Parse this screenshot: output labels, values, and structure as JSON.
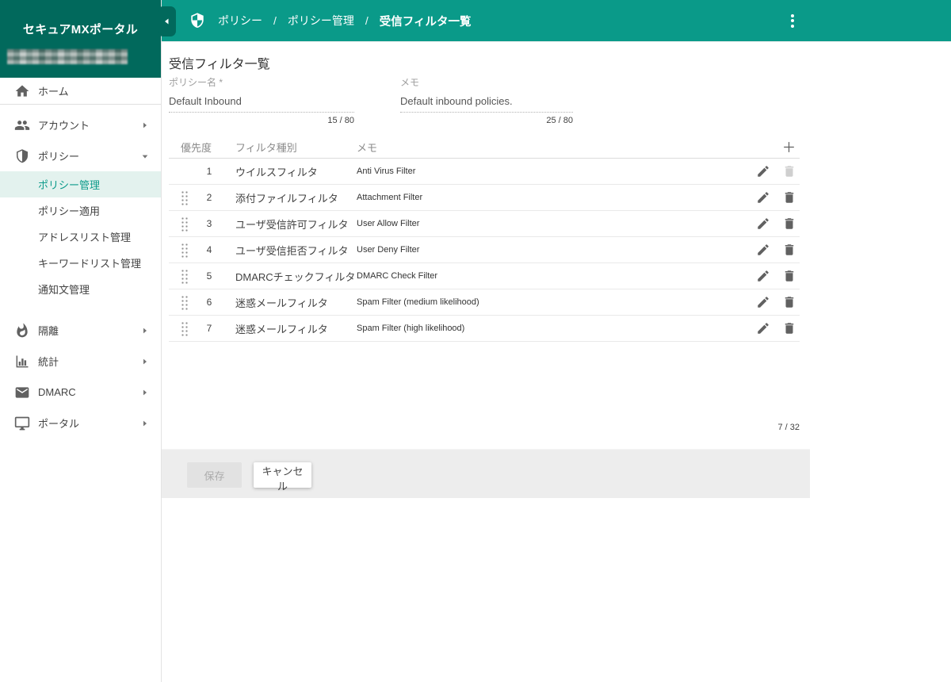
{
  "app": {
    "title": "セキュアMXポータル"
  },
  "breadcrumb": {
    "separator": "/",
    "items": [
      "ポリシー",
      "ポリシー管理",
      "受信フィルタ一覧"
    ]
  },
  "sidebar": {
    "items": [
      {
        "label": "ホーム",
        "icon": "home-icon"
      },
      {
        "label": "アカウント",
        "icon": "people-icon",
        "expandable": true
      },
      {
        "label": "ポリシー",
        "icon": "shield-icon",
        "expanded": true
      },
      {
        "label": "隔離",
        "icon": "flame-icon",
        "expandable": true
      },
      {
        "label": "統計",
        "icon": "bar-chart-icon",
        "expandable": true
      },
      {
        "label": "DMARC",
        "icon": "mail-icon",
        "expandable": true
      },
      {
        "label": "ポータル",
        "icon": "monitor-icon",
        "expandable": true
      }
    ],
    "policy_submenu": [
      "ポリシー管理",
      "ポリシー適用",
      "アドレスリスト管理",
      "キーワードリスト管理",
      "通知文管理"
    ],
    "active_item": "ポリシー管理"
  },
  "page": {
    "title": "受信フィルタ一覧",
    "fields": [
      {
        "label": "ポリシー名 *",
        "value": "Default Inbound",
        "counter": "15 / 80"
      },
      {
        "label": "メモ",
        "value": "Default inbound policies.",
        "counter": "25 / 80"
      }
    ],
    "table": {
      "headers": {
        "priority": "優先度",
        "type": "フィルタ種別",
        "memo": "メモ"
      },
      "rows": [
        {
          "priority": "1",
          "type": "ウイルスフィルタ",
          "memo": "Anti Virus Filter",
          "draggable": false,
          "deletable": false
        },
        {
          "priority": "2",
          "type": "添付ファイルフィルタ",
          "memo": "Attachment Filter",
          "draggable": true,
          "deletable": true
        },
        {
          "priority": "3",
          "type": "ユーザ受信許可フィルタ",
          "memo": "User Allow Filter",
          "draggable": true,
          "deletable": true
        },
        {
          "priority": "4",
          "type": "ユーザ受信拒否フィルタ",
          "memo": "User Deny Filter",
          "draggable": true,
          "deletable": true
        },
        {
          "priority": "5",
          "type": "DMARCチェックフィルタ",
          "memo": "DMARC Check Filter",
          "draggable": true,
          "deletable": true
        },
        {
          "priority": "6",
          "type": "迷惑メールフィルタ",
          "memo": "Spam Filter (medium likelihood)",
          "draggable": true,
          "deletable": true
        },
        {
          "priority": "7",
          "type": "迷惑メールフィルタ",
          "memo": "Spam Filter (high likelihood)",
          "draggable": true,
          "deletable": true
        }
      ],
      "count": "7 / 32"
    },
    "footer": {
      "save_label": "保存",
      "cancel_label": "キャンセル"
    }
  },
  "colors": {
    "topbar_teal": "#0a9a89",
    "sidebar_header_teal": "#01695c",
    "active_item_bg": "#e3f2ee",
    "active_item_text": "#0b9a8a",
    "footer_bar": "#ededed"
  }
}
